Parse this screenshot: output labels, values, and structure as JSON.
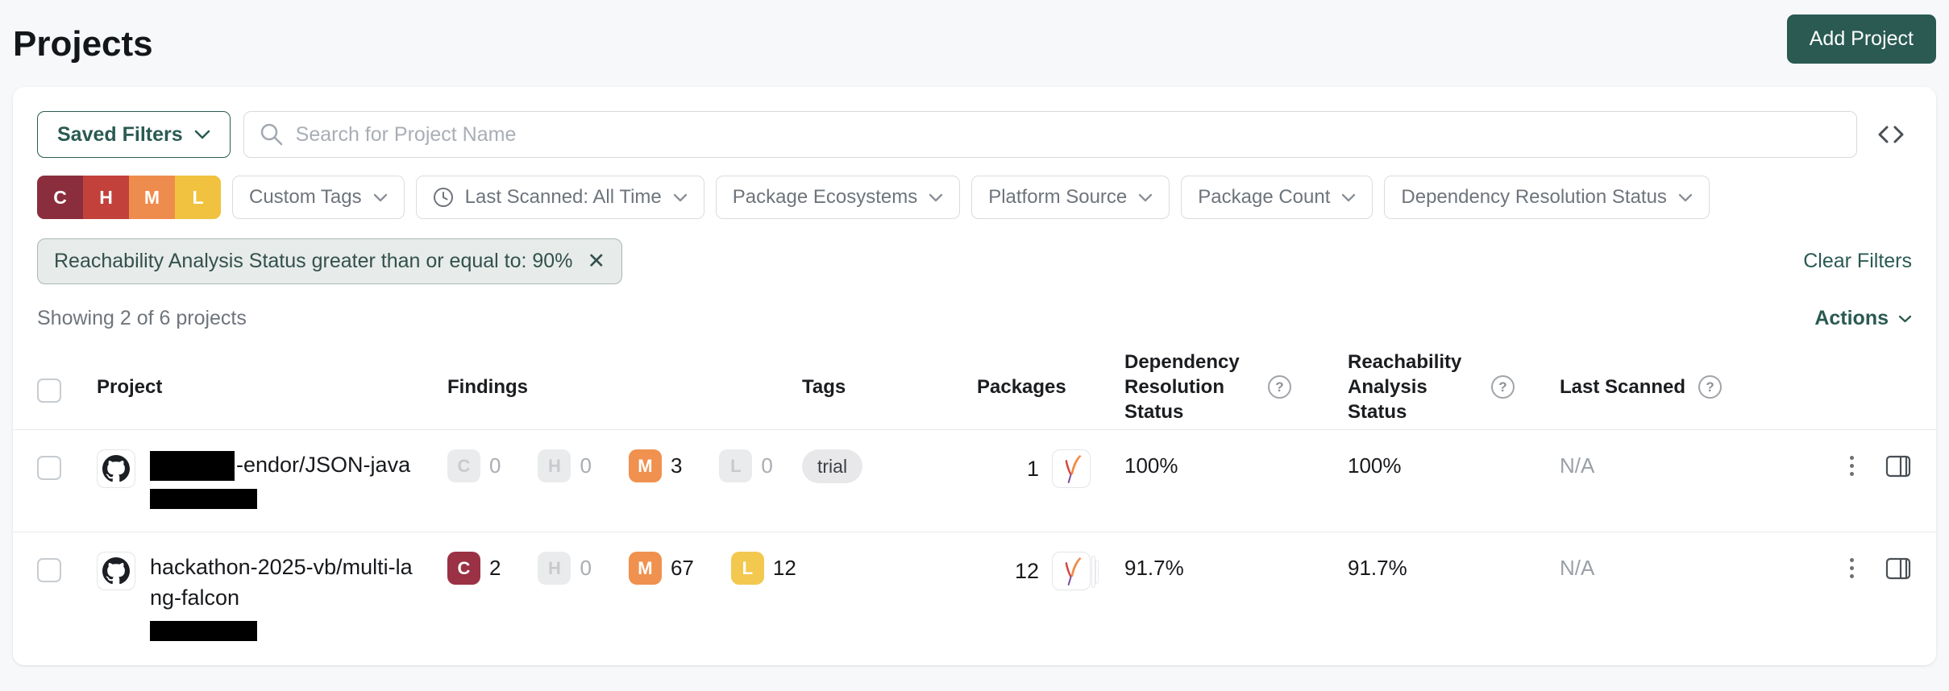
{
  "accent_color": "#2a5a52",
  "page": {
    "title": "Projects"
  },
  "header": {
    "add_project": "Add Project"
  },
  "toolbar": {
    "saved_filters": "Saved Filters",
    "search_placeholder": "Search for Project Name"
  },
  "filters": {
    "severity": [
      {
        "label": "C",
        "color": "#8a2e3d"
      },
      {
        "label": "H",
        "color": "#c2413a"
      },
      {
        "label": "M",
        "color": "#ee8c4d"
      },
      {
        "label": "L",
        "color": "#f1c23f"
      }
    ],
    "dropdowns": [
      {
        "label": "Custom Tags"
      },
      {
        "label": "Last Scanned: All Time",
        "icon": "clock"
      },
      {
        "label": "Package Ecosystems"
      },
      {
        "label": "Platform Source"
      },
      {
        "label": "Package Count"
      },
      {
        "label": "Dependency Resolution Status"
      }
    ],
    "applied_chip": "Reachability Analysis Status greater than or equal to: 90%",
    "clear_filters": "Clear Filters"
  },
  "summary": {
    "showing": "Showing 2 of 6 projects",
    "actions": "Actions"
  },
  "table": {
    "headers": {
      "project": "Project",
      "findings": "Findings",
      "tags": "Tags",
      "packages": "Packages",
      "dependency_resolution_status": "Dependency Resolution Status",
      "reachability_analysis_status": "Reachability Analysis Status",
      "last_scanned": "Last Scanned"
    },
    "rows": [
      {
        "source": "github",
        "name": "-endor/JSON-java",
        "name_prefix_redacted": true,
        "findings": {
          "critical": "0",
          "high": "0",
          "medium": "3",
          "low": "0"
        },
        "tags": [
          "trial"
        ],
        "package_count": "1",
        "package_ecosystem": "maven",
        "dependency_resolution_status": "100%",
        "reachability_analysis_status": "100%",
        "last_scanned": "N/A"
      },
      {
        "source": "github",
        "name": "hackathon-2025-vb/multi-lang-falcon",
        "findings": {
          "critical": "2",
          "high": "0",
          "medium": "67",
          "low": "12"
        },
        "tags": [],
        "package_count": "12",
        "package_ecosystem": "maven",
        "dependency_resolution_status": "91.7%",
        "reachability_analysis_status": "91.7%",
        "last_scanned": "N/A"
      }
    ]
  },
  "severity_colors": {
    "critical": "#9a3144",
    "medium": "#f0914f",
    "low": "#f2c84f",
    "disabled": "#eaebed"
  }
}
